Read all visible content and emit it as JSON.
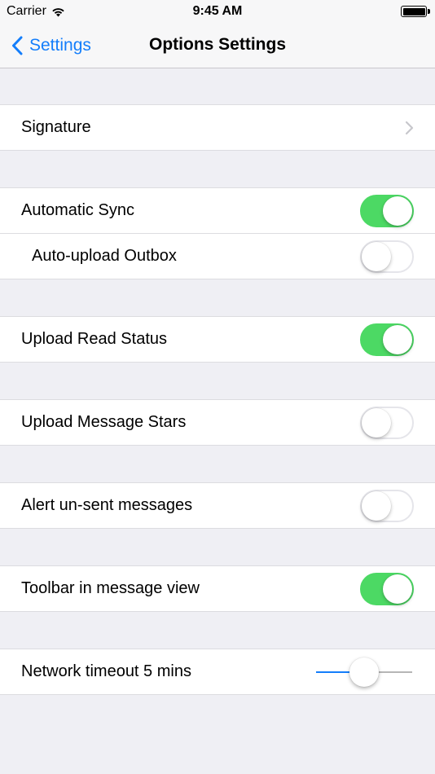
{
  "status_bar": {
    "carrier": "Carrier",
    "time": "9:45 AM",
    "icons": [
      "wifi-icon",
      "battery-icon"
    ]
  },
  "nav": {
    "back_label": "Settings",
    "title": "Options Settings"
  },
  "colors": {
    "accent": "#147efb",
    "toggle_on": "#4cd964",
    "background": "#efeff4"
  },
  "rows": {
    "signature": {
      "label": "Signature"
    },
    "automatic_sync": {
      "label": "Automatic Sync",
      "on": true
    },
    "auto_upload_outbox": {
      "label": "Auto-upload Outbox",
      "on": false
    },
    "upload_read_status": {
      "label": "Upload Read Status",
      "on": true
    },
    "upload_message_stars": {
      "label": "Upload Message Stars",
      "on": false
    },
    "alert_unsent": {
      "label": "Alert un-sent messages",
      "on": false
    },
    "toolbar_message_view": {
      "label": "Toolbar in message view",
      "on": true
    },
    "network_timeout": {
      "label": "Network timeout 5 mins",
      "slider_fraction": 0.5
    }
  }
}
